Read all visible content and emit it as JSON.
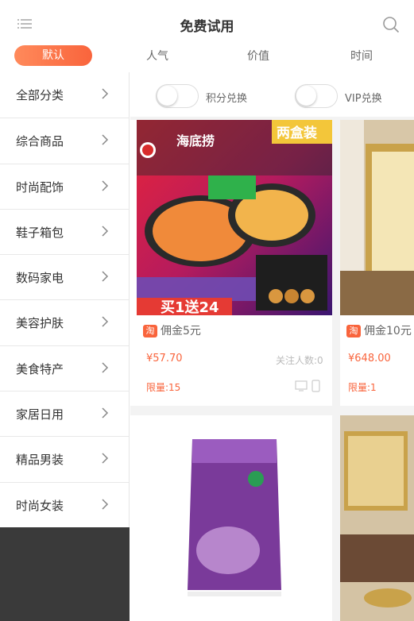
{
  "header": {
    "title": "免费试用",
    "menu_icon": "menu-icon",
    "search_icon": "search-icon"
  },
  "tabs": {
    "active": "默认",
    "items": [
      "人气",
      "价值",
      "时间"
    ]
  },
  "sidebar": {
    "items": [
      "全部分类",
      "综合商品",
      "时尚配饰",
      "鞋子箱包",
      "数码家电",
      "美容护肤",
      "美食特产",
      "家居日用",
      "精品男装",
      "时尚女装"
    ]
  },
  "filters": {
    "points_label": "积分兑换",
    "vip_label": "VIP兑换"
  },
  "products": [
    {
      "commission": "佣金5元",
      "price": "¥57.70",
      "follow": "关注人数:0",
      "limit": "限量:15",
      "image_text": {
        "brand": "海底捞",
        "box": "两盒装",
        "promo": "买1送24"
      }
    },
    {
      "commission": "佣金10元",
      "price": "¥648.00",
      "limit": "限量:1"
    }
  ],
  "colors": {
    "accent": "#f9643c",
    "sidebar_bottom": "#3a3a3a"
  }
}
